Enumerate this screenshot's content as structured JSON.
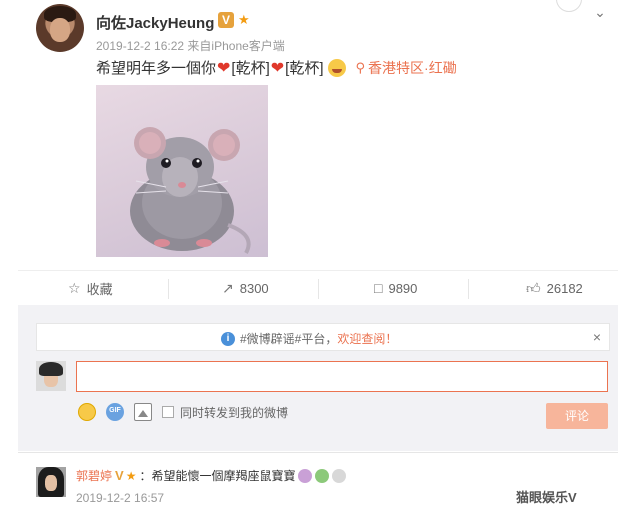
{
  "post": {
    "username": "向佐JackyHeung",
    "verified_badge": "V",
    "timestamp": "2019-12-2 16:22",
    "source": "来自iPhone客户端",
    "text_start": "希望明年多一個你",
    "emote_cheers": "[乾杯]",
    "location": "香港特区·红磡",
    "icons": {
      "verified": "verified-v-icon",
      "medal": "medal-icon",
      "heart": "heart-icon",
      "lol": "lol-emoji-icon",
      "pin": "location-pin-icon",
      "more": "chevron-down-icon"
    }
  },
  "actions": {
    "favorite": "收藏",
    "forward": "8300",
    "comment": "9890",
    "like": "26182"
  },
  "comment_box": {
    "notice_topic": "#微博辟谣#平台，",
    "notice_welcome": "欢迎查阅！",
    "sync_label": "同时转发到我的微博",
    "submit_label": "评论"
  },
  "comment": {
    "name": "郭碧婷",
    "verified_badge": "V",
    "text": "：希望能懷一個摩羯座鼠寶寶",
    "time": "2019-12-2 16:57"
  },
  "watermark": "猫眼娱乐V",
  "colors": {
    "accent": "#eb7350",
    "badge": "#e6a23c",
    "info": "#4a90d9"
  }
}
